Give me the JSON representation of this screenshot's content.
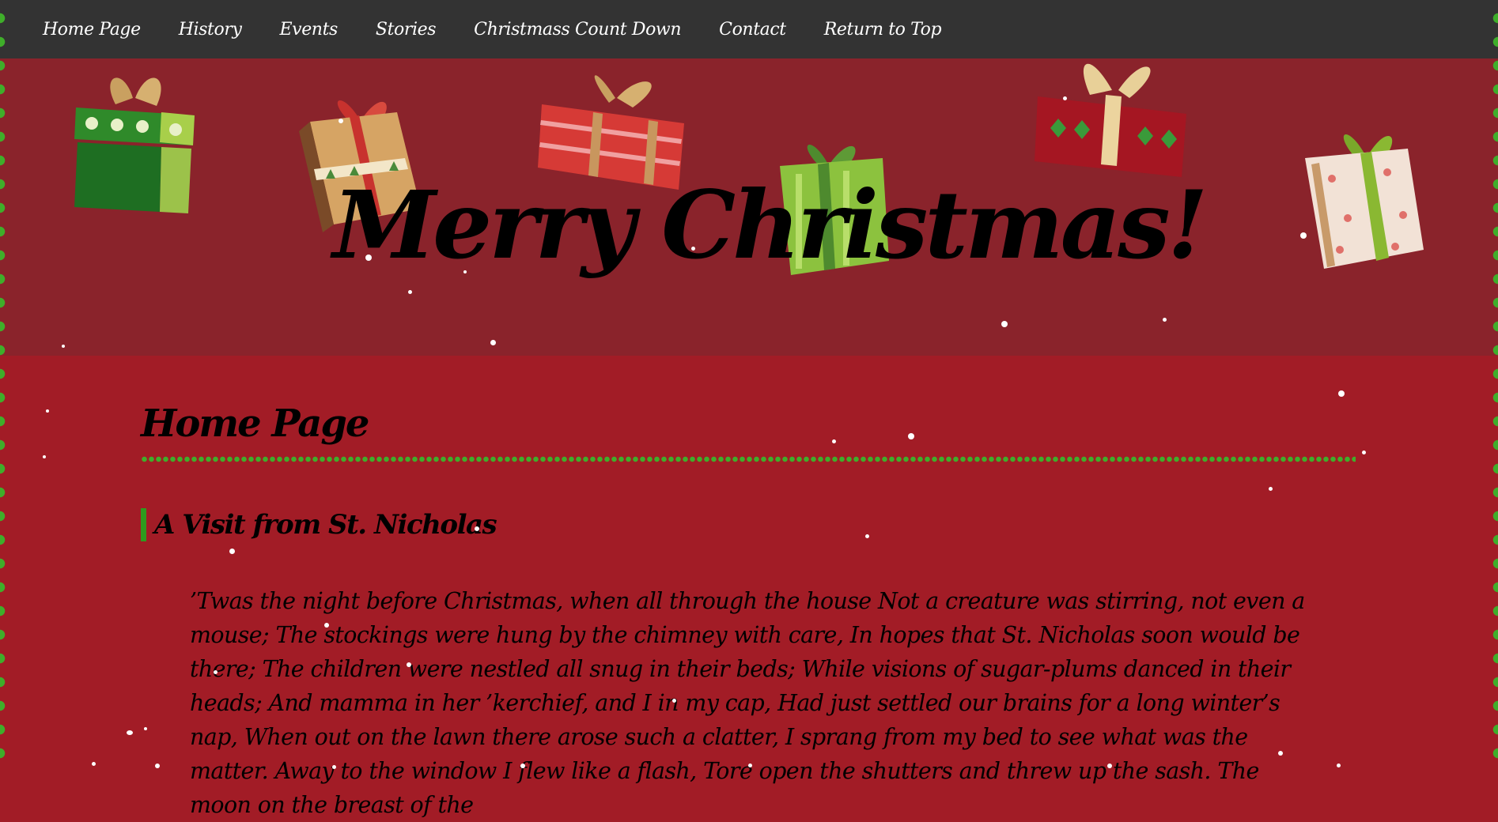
{
  "nav": {
    "items": [
      "Home Page",
      "History",
      "Events",
      "Stories",
      "Christmass Count Down",
      "Contact",
      "Return to Top"
    ]
  },
  "hero": {
    "title": "Merry Christmas!"
  },
  "main": {
    "heading": "Home Page",
    "subheading": "A Visit from St. Nicholas",
    "poem": "’Twas the night before Christmas, when all through the house Not a creature was stirring, not even a mouse; The stockings were hung by the chimney with care, In hopes that St. Nicholas soon would be there; The children were nestled all snug in their beds; While visions of sugar-plums danced in their heads; And mamma in her ’kerchief, and I in my cap, Had just settled our brains for a long winter’s nap, When out on the lawn there arose such a clatter, I sprang from my bed to see what was the matter. Away to the window I flew like a flash, Tore open the shutters and threw up the sash. The moon on the breast of the"
  },
  "colors": {
    "nav_bg": "#333333",
    "hero_bg": "#8a232b",
    "page_bg": "#a21c26",
    "accent_green": "#3fae2a"
  },
  "icons": [
    "gift-icon",
    "snowflake-icon"
  ]
}
